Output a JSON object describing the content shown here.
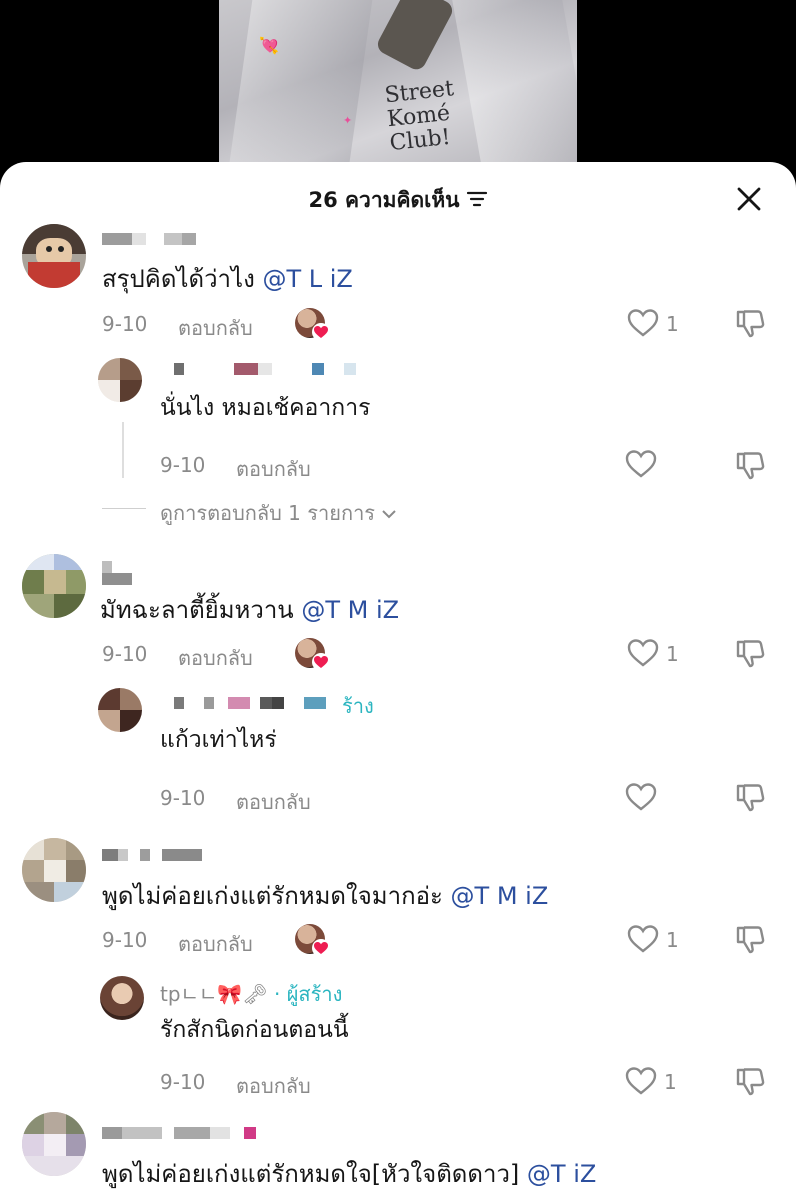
{
  "video": {
    "print_lines": [
      "Street",
      "Komé",
      "Club!"
    ]
  },
  "sheet": {
    "title": "26 ความคิดเห็น"
  },
  "icons": {
    "filter": "filter-icon",
    "close": "close-icon",
    "like": "heart-outline-icon",
    "dislike": "thumbs-down-icon",
    "chevron": "chevron-down-icon"
  },
  "colors": {
    "mention": "#2c4f9e",
    "creator": "#2bb5c0",
    "muted": "#8a8a8a",
    "liked_heart": "#ee1d52"
  },
  "comments": [
    {
      "text": "สรุปคิดได้ว่าไง",
      "mention": "@T L iZ",
      "date": "9-10",
      "reply_label": "ตอบกลับ",
      "likes": "1",
      "replies": [
        {
          "text": "นั่นไง หมอเช้คอาการ",
          "date": "9-10",
          "reply_label": "ตอบกลับ",
          "likes": ""
        }
      ],
      "view_more": "ดูการตอบกลับ 1 รายการ"
    },
    {
      "text": "มัทฉะลาตี้ยิ้มหวาน",
      "mention": "@T M iZ",
      "date": "9-10",
      "reply_label": "ตอบกลับ",
      "likes": "1",
      "replies": [
        {
          "user_suffix": "ร้าง",
          "text": "แก้วเท่าไหร่",
          "date": "9-10",
          "reply_label": "ตอบกลับ",
          "likes": ""
        }
      ]
    },
    {
      "text": "พูดไม่ค่อยเก่งแต่รักหมดใจมากอ่ะ",
      "mention": "@T M iZ",
      "date": "9-10",
      "reply_label": "ตอบกลับ",
      "likes": "1",
      "replies": [
        {
          "username": "tpㄴㄴ🎀🗝",
          "creator_tag": "· ผู้สร้าง",
          "text": "รักสักนิดก่อนตอนนี้",
          "date": "9-10",
          "reply_label": "ตอบกลับ",
          "likes": "1"
        }
      ]
    },
    {
      "text": "พูดไม่ค่อยเก่งแต่รักหมดใจ[หัวใจติดดาว]",
      "mention": "@T iZ"
    }
  ]
}
